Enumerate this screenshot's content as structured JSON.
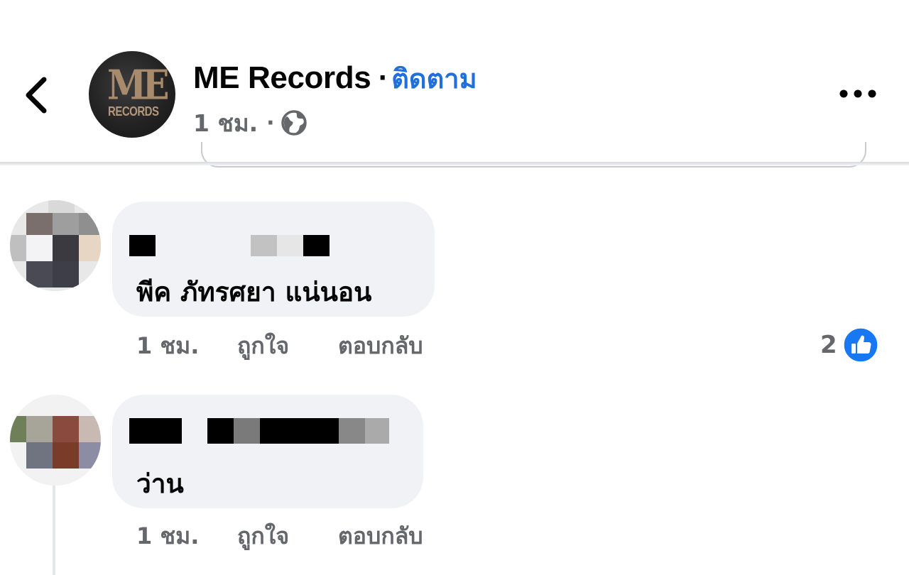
{
  "header": {
    "page_name": "ME Records",
    "separator": "·",
    "follow_label": "ติดตาม",
    "timestamp": "1 ชม.",
    "meta_separator": "·",
    "avatar_logo": {
      "line1": "ME",
      "line2": "RECORDS"
    },
    "icons": {
      "back": "chevron-left-icon",
      "privacy": "globe-icon",
      "more": "more-horizontal-icon"
    }
  },
  "comments": [
    {
      "author": "[redacted]",
      "text": "พีค ภัทรศยา แน่นอน",
      "time": "1 ชม.",
      "like_label": "ถูกใจ",
      "reply_label": "ตอบกลับ",
      "reaction_count": "2",
      "reaction_icon": "thumbs-up-icon"
    },
    {
      "author": "[redacted]",
      "text": "ว่าน",
      "time": "1 ชม.",
      "like_label": "ถูกใจ",
      "reply_label": "ตอบกลับ"
    }
  ],
  "colors": {
    "accent": "#216fdb",
    "secondary_text": "#65676b",
    "bubble": "#f0f2f5",
    "like_badge": "#1877f2"
  }
}
